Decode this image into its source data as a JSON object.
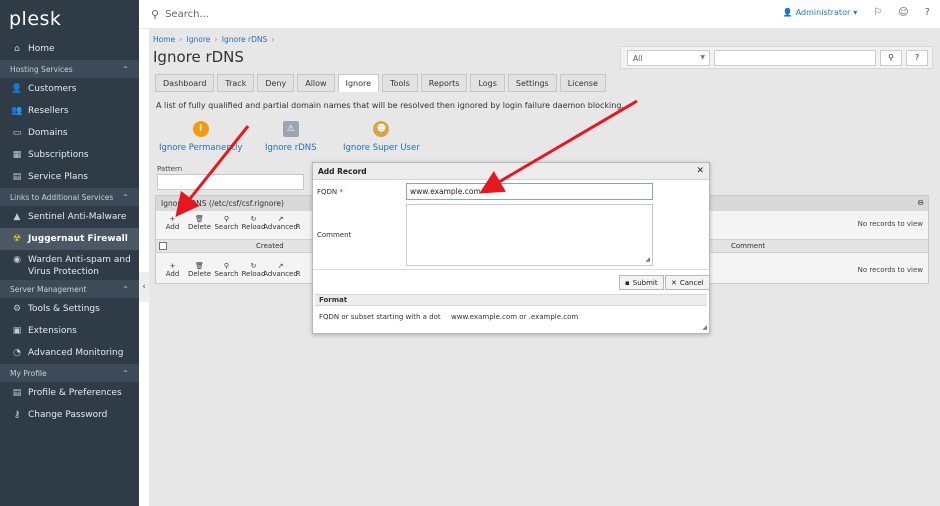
{
  "app": {
    "logo": "plesk"
  },
  "sidebar": {
    "home": "Home",
    "sections": [
      {
        "title": "Hosting Services",
        "items": [
          "Customers",
          "Resellers",
          "Domains",
          "Subscriptions",
          "Service Plans"
        ]
      },
      {
        "title": "Links to Additional Services",
        "items": [
          "Sentinel Anti-Malware",
          "Juggernaut Firewall",
          "Warden Anti-spam and Virus Protection"
        ]
      },
      {
        "title": "Server Management",
        "items": [
          "Tools & Settings",
          "Extensions",
          "Advanced Monitoring"
        ]
      },
      {
        "title": "My Profile",
        "items": [
          "Profile & Preferences",
          "Change Password"
        ]
      }
    ]
  },
  "topbar": {
    "search_placeholder": "Search...",
    "user": "Administrator"
  },
  "breadcrumb": [
    "Home",
    "Ignore",
    "Ignore rDNS"
  ],
  "page": {
    "title": "Ignore rDNS",
    "filter_selected": "All",
    "tabs": [
      "Dashboard",
      "Track",
      "Deny",
      "Allow",
      "Ignore",
      "Tools",
      "Reports",
      "Logs",
      "Settings",
      "License"
    ],
    "active_tab": "Ignore",
    "description": "A list of fully qualified and partial domain names that will be resolved then ignored by login failure daemon blocking.",
    "quick_links": [
      "Ignore Permanently",
      "Ignore rDNS",
      "Ignore Super User"
    ],
    "pattern_label": "Pattern"
  },
  "grid": {
    "title": "Ignore rDNS (/etc/csf/csf.rignore)",
    "tools": [
      "Add",
      "Delete",
      "Search",
      "Reload",
      "Advanced",
      "R"
    ],
    "no_records": "No records to view",
    "columns": {
      "created": "Created",
      "comment": "Comment"
    }
  },
  "dialog": {
    "title": "Add Record",
    "fqdn_label": "FQDN",
    "required_mark": "*",
    "fqdn_value": "www.example.com",
    "comment_label": "Comment",
    "submit": "Submit",
    "cancel": "Cancel",
    "format_title": "Format",
    "format_desc": "FQDN or subset starting with a dot",
    "format_example": "www.example.com or .example.com"
  },
  "colors": {
    "sidebar_bg": "#2f3b47",
    "link": "#1f6fb5",
    "annotation_arrow": "#e8161e"
  }
}
